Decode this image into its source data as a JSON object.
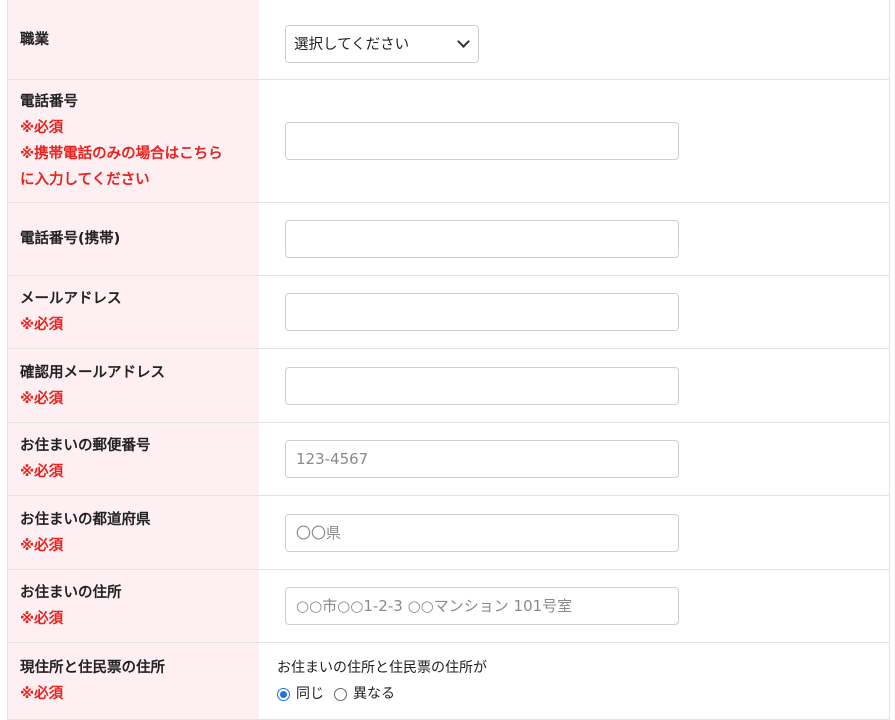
{
  "form": {
    "occupation": {
      "label": "職業",
      "select_value": "選択してください"
    },
    "phone": {
      "label": "電話番号",
      "required": "※必須",
      "note_line1": "※携帯電話のみの場合はこちら",
      "note_line2": "に入力してください",
      "value": ""
    },
    "mobile_phone": {
      "label": "電話番号(携帯)",
      "value": ""
    },
    "email": {
      "label": "メールアドレス",
      "required": "※必須",
      "value": ""
    },
    "email_confirm": {
      "label": "確認用メールアドレス",
      "required": "※必須",
      "value": ""
    },
    "postal_code": {
      "label": "お住まいの郵便番号",
      "required": "※必須",
      "placeholder": "123-4567"
    },
    "prefecture": {
      "label": "お住まいの都道府県",
      "required": "※必須",
      "placeholder": "〇〇県"
    },
    "address": {
      "label": "お住まいの住所",
      "required": "※必須",
      "placeholder": "○○市○○1-2-3 ○○マンション 101号室"
    },
    "residence_match": {
      "label": "現住所と住民票の住所",
      "required": "※必須",
      "prompt": "お住まいの住所と住民票の住所が",
      "options": [
        "同じ",
        "異なる"
      ],
      "selected": "同じ"
    }
  },
  "colors": {
    "label_background": "#fdeff2",
    "required_text": "#e8231f",
    "border": "#e4e4e4",
    "radio_accent": "#1a73e8"
  }
}
